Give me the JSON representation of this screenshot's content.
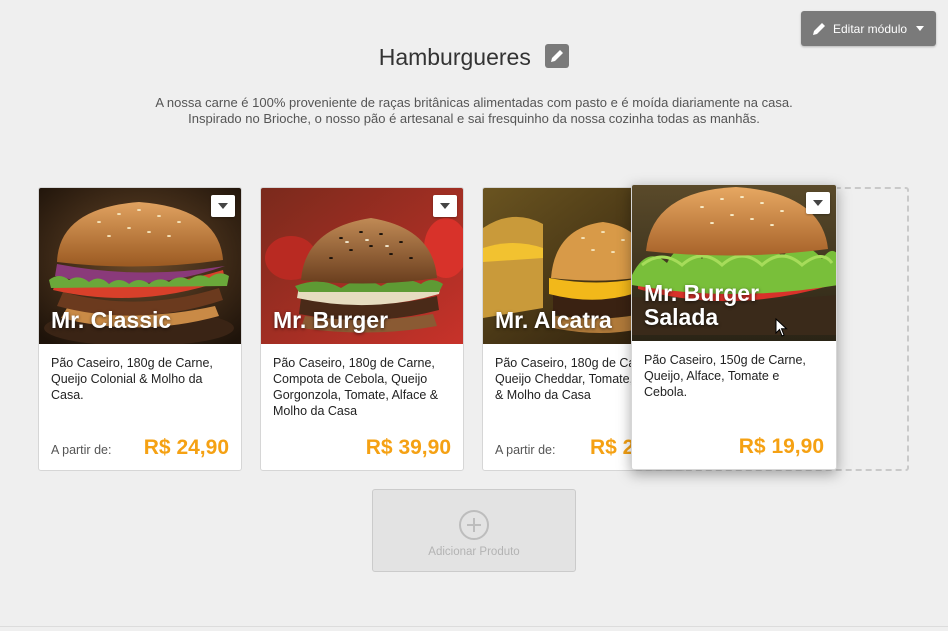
{
  "header": {
    "edit_module_label": "Editar módulo",
    "title": "Hamburgueres",
    "description": "A nossa carne é 100% proveniente de raças britânicas alimentadas com pasto e é moída diariamente na casa. Inspirado no Brioche, o nosso pão é artesanal e sai fresquinho da nossa cozinha todas as manhãs."
  },
  "products": [
    {
      "name": "Mr. Classic",
      "description": "Pão Caseiro, 180g de Carne, Queijo Colonial & Molho da Casa.",
      "from_label": "A partir de:",
      "price": "R$ 24,90"
    },
    {
      "name": "Mr. Burger",
      "description": "Pão Caseiro, 180g de Carne, Compota de Cebola, Queijo Gorgonzola, Tomate, Alface & Molho da Casa",
      "from_label": "",
      "price": "R$ 39,90"
    },
    {
      "name": "Mr. Alcatra",
      "description": "Pão Caseiro, 180g de Carne, Queijo Cheddar, Tomate, Alface & Molho da Casa",
      "from_label": "A partir de:",
      "price": "R$ 2"
    },
    {
      "name_line1": "Mr. Burger",
      "name_line2": "Salada",
      "description": "Pão Caseiro, 150g de Carne, Queijo, Alface, Tomate e Cebola.",
      "price": "R$ 19,90"
    }
  ],
  "add_product": {
    "label": "Adicionar Produto"
  },
  "colors": {
    "price": "#f5a113",
    "button_gray": "#7a7a7a",
    "background": "#efefef"
  }
}
